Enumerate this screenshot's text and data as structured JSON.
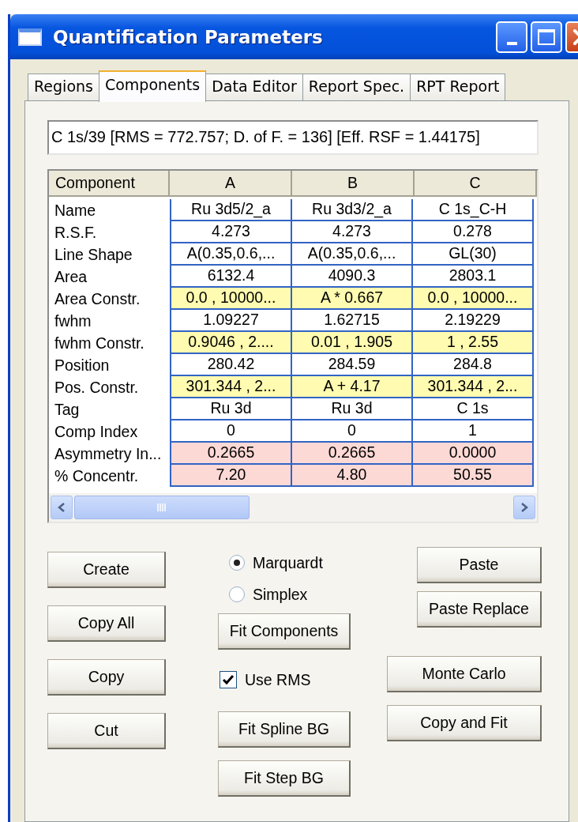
{
  "window": {
    "title": "Quantification Parameters"
  },
  "tabs": [
    {
      "label": "Regions",
      "selected": false
    },
    {
      "label": "Components",
      "selected": true
    },
    {
      "label": "Data Editor",
      "selected": false
    },
    {
      "label": "Report Spec.",
      "selected": false
    },
    {
      "label": "RPT Report",
      "selected": false
    }
  ],
  "summary_field": {
    "value": "C 1s/39 [RMS = 772.757; D. of F. = 136] [Eff. RSF = 1.44175]"
  },
  "table": {
    "columns": [
      "Component",
      "A",
      "B",
      "C"
    ],
    "rows": [
      {
        "kind": "value",
        "cells": [
          "Name",
          "Ru 3d5/2_a",
          "Ru 3d3/2_a",
          "C 1s_C-H"
        ]
      },
      {
        "kind": "value",
        "cells": [
          "R.S.F.",
          "4.273",
          "4.273",
          "0.278"
        ]
      },
      {
        "kind": "value",
        "cells": [
          "Line Shape",
          "A(0.35,0.6,...",
          "A(0.35,0.6,...",
          "GL(30)"
        ]
      },
      {
        "kind": "value",
        "cells": [
          "Area",
          "6132.4",
          "4090.3",
          "2803.1"
        ]
      },
      {
        "kind": "constraint",
        "cells": [
          "Area Constr.",
          "0.0 , 10000...",
          "A * 0.667",
          "0.0 , 10000..."
        ]
      },
      {
        "kind": "value",
        "cells": [
          "fwhm",
          "1.09227",
          "1.62715",
          "2.19229"
        ]
      },
      {
        "kind": "constraint",
        "cells": [
          "fwhm Constr.",
          "0.9046 , 2....",
          "0.01 , 1.905",
          "1 , 2.55"
        ]
      },
      {
        "kind": "value",
        "cells": [
          "Position",
          "280.42",
          "284.59",
          "284.8"
        ]
      },
      {
        "kind": "constraint",
        "cells": [
          "Pos. Constr.",
          "301.344 , 2...",
          "A + 4.17",
          "301.344 , 2..."
        ]
      },
      {
        "kind": "value",
        "cells": [
          "Tag",
          "Ru 3d",
          "Ru 3d",
          "C 1s"
        ]
      },
      {
        "kind": "value",
        "cells": [
          "Comp Index",
          "0",
          "0",
          "1"
        ]
      },
      {
        "kind": "result",
        "cells": [
          "Asymmetry In...",
          "0.2665",
          "0.2665",
          "0.0000"
        ]
      },
      {
        "kind": "result",
        "cells": [
          "% Concentr.",
          "7.20",
          "4.80",
          "50.55"
        ]
      }
    ]
  },
  "controls": [
    [
      {
        "kind": "button",
        "label": "Create"
      },
      {
        "kind": "button",
        "label": "Copy All"
      },
      {
        "kind": "button",
        "label": "Copy"
      },
      {
        "kind": "button",
        "label": "Cut"
      }
    ],
    [
      {
        "kind": "radio",
        "label": "Marquardt",
        "selected": true
      },
      {
        "kind": "radio",
        "label": "Simplex",
        "selected": false
      },
      {
        "kind": "button",
        "label": "Fit Components"
      },
      {
        "kind": "checkbox",
        "label": "Use RMS",
        "checked": true
      },
      {
        "kind": "button",
        "label": "Fit Spline BG"
      },
      {
        "kind": "button",
        "label": "Fit Step BG"
      }
    ],
    [
      {
        "kind": "button",
        "label": "Paste"
      },
      {
        "kind": "button",
        "label": "Paste Replace"
      },
      {
        "kind": "button",
        "label": "Monte Carlo"
      },
      {
        "kind": "button",
        "label": "Copy and Fit"
      }
    ]
  ]
}
